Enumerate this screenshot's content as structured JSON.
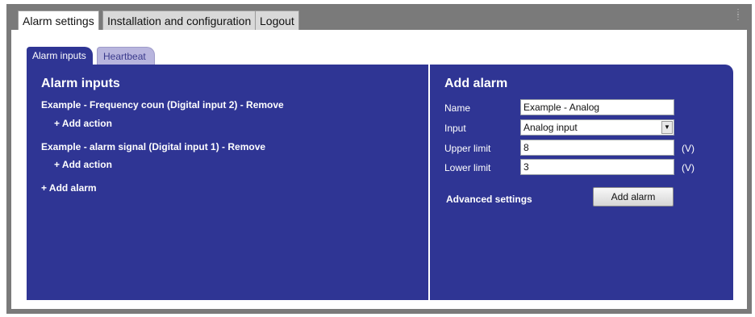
{
  "top_tabs": [
    {
      "label": "Alarm settings",
      "active": true
    },
    {
      "label": "Installation and configuration",
      "active": false
    },
    {
      "label": "Logout",
      "active": false
    }
  ],
  "sub_tabs": [
    {
      "label": "Alarm inputs",
      "active": true
    },
    {
      "label": "Heartbeat",
      "active": false
    }
  ],
  "alarm_inputs": {
    "heading": "Alarm inputs",
    "alarms": [
      {
        "label": "Example - Frequency coun (Digital input 2)",
        "separator": " - ",
        "remove": "Remove",
        "add_action": "+ Add action"
      },
      {
        "label": "Example - alarm signal (Digital input 1)",
        "separator": " - ",
        "remove": "Remove",
        "add_action": "+ Add action"
      }
    ],
    "add_alarm": "+ Add alarm"
  },
  "add_alarm_form": {
    "heading": "Add alarm",
    "name": {
      "label": "Name",
      "value": "Example - Analog"
    },
    "input": {
      "label": "Input",
      "value": "Analog input"
    },
    "upper_limit": {
      "label": "Upper limit",
      "value": "8",
      "unit": "(V)"
    },
    "lower_limit": {
      "label": "Lower limit",
      "value": "3",
      "unit": "(V)"
    },
    "advanced_settings": "Advanced settings",
    "submit_label": "Add alarm"
  },
  "colors": {
    "panel": "#2f3594",
    "inactive_tab": "#b8b5de",
    "frame": "#7a7a7a"
  },
  "icons": {
    "select_arrow": "chevron-down-icon"
  }
}
